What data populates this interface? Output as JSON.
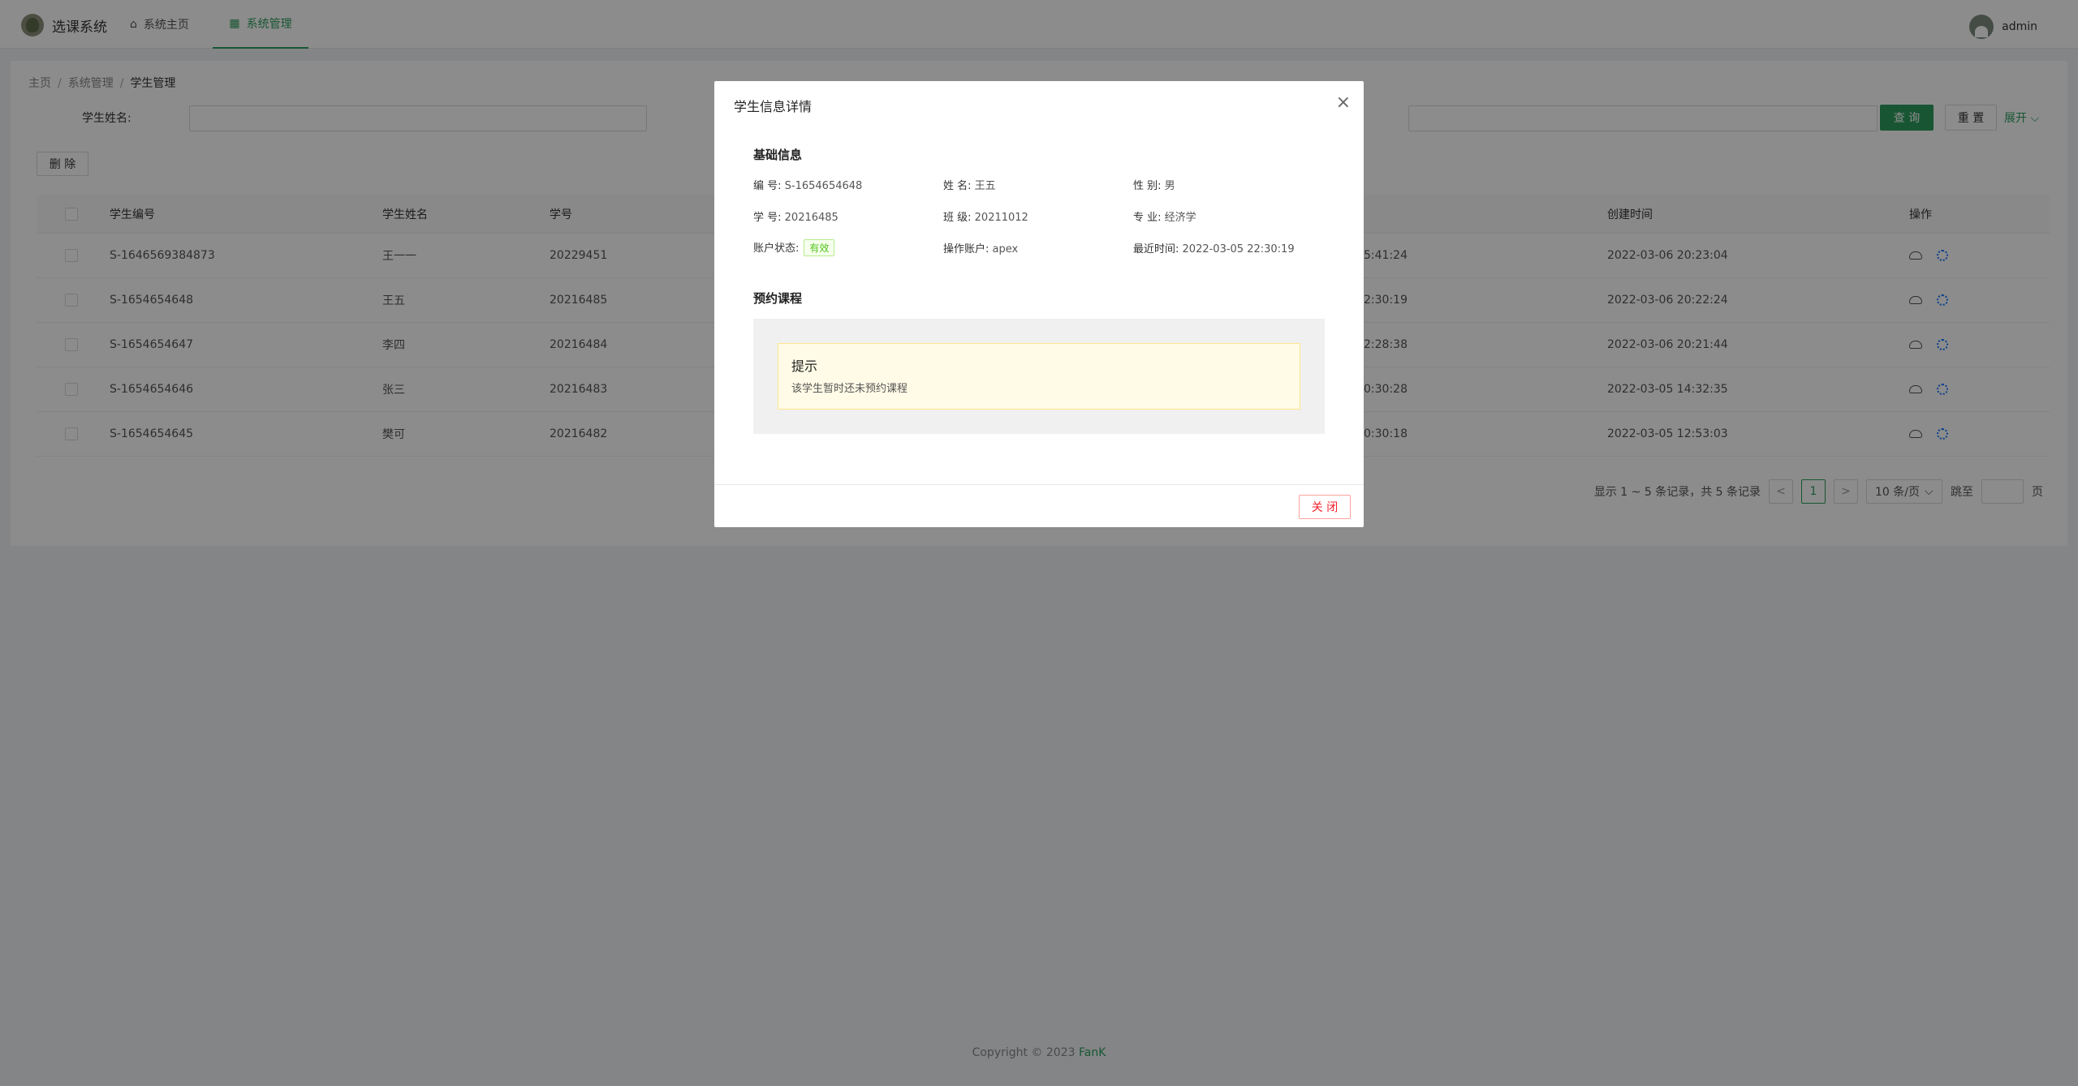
{
  "header": {
    "logo_text": "选课系统",
    "nav": [
      {
        "label": "系统主页"
      },
      {
        "label": "系统管理"
      }
    ],
    "user": "admin"
  },
  "breadcrumb": [
    "主页",
    "系统管理",
    "学生管理"
  ],
  "search": {
    "label": "学生姓名:",
    "query_label": "查 询",
    "reset_label": "重 置",
    "expand_label": "展开"
  },
  "toolbar": {
    "delete_label": "删 除"
  },
  "table": {
    "columns": [
      "学生编号",
      "学生姓名",
      "学号",
      "创建时间",
      "操作"
    ],
    "rows": [
      {
        "id": "S-1646569384873",
        "name": "王一一",
        "no": "20229451",
        "partial": "5:41:24",
        "created": "2022-03-06 20:23:04"
      },
      {
        "id": "S-1654654648",
        "name": "王五",
        "no": "20216485",
        "partial": "2:30:19",
        "created": "2022-03-06 20:22:24"
      },
      {
        "id": "S-1654654647",
        "name": "李四",
        "no": "20216484",
        "partial": "2:28:38",
        "created": "2022-03-06 20:21:44"
      },
      {
        "id": "S-1654654646",
        "name": "张三",
        "no": "20216483",
        "partial": "0:30:28",
        "created": "2022-03-05 14:32:35"
      },
      {
        "id": "S-1654654645",
        "name": "樊可",
        "no": "20216482",
        "partial": "0:30:18",
        "created": "2022-03-05 12:53:03"
      }
    ]
  },
  "pager": {
    "summary": "显示 1 ~ 5 条记录，共 5 条记录",
    "prev": "<",
    "page": "1",
    "next": ">",
    "size": "10 条/页",
    "jump": "跳至",
    "unit": "页"
  },
  "footer": {
    "copy": "Copyright © 2023 ",
    "brand": "FanK"
  },
  "modal": {
    "title": "学生信息详情",
    "close_icon": "×",
    "basic_title": "基础信息",
    "fields": {
      "code_k": "编 号:",
      "code_v": "S-1654654648",
      "name_k": "姓 名:",
      "name_v": "王五",
      "sex_k": "性 别:",
      "sex_v": "男",
      "no_k": "学 号:",
      "no_v": "20216485",
      "class_k": "班 级:",
      "class_v": "20211012",
      "major_k": "专 业:",
      "major_v": "经济学",
      "status_k": "账户状态:",
      "status_v": "有效",
      "op_k": "操作账户:",
      "op_v": "apex",
      "time_k": "最近时间:",
      "time_v": "2022-03-05 22:30:19"
    },
    "course_title": "预约课程",
    "alert_title": "提示",
    "alert_desc": "该学生暂时还未预约课程",
    "close_label": "关 闭"
  }
}
